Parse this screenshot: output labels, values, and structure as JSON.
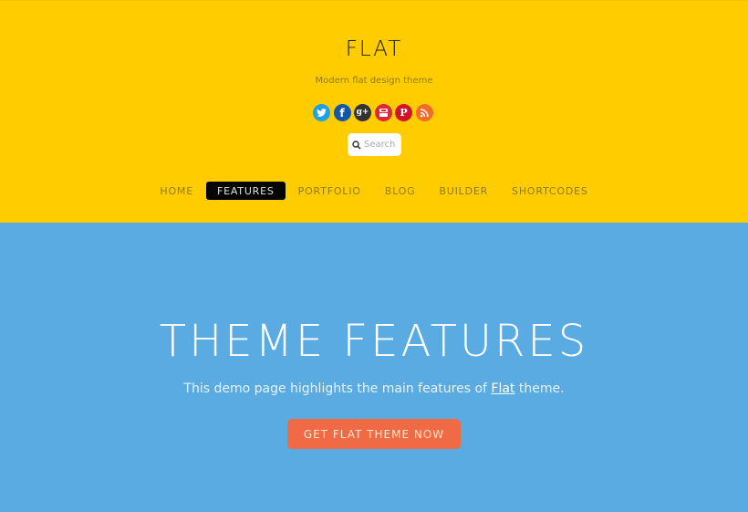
{
  "header": {
    "site_title": "FLAT",
    "tagline": "Modern flat design theme",
    "social": [
      {
        "name": "twitter-icon",
        "glyph": "t",
        "color": "#1da1e2"
      },
      {
        "name": "facebook-icon",
        "glyph": "f",
        "color": "#1457a6"
      },
      {
        "name": "google-plus-icon",
        "glyph": "g+",
        "color": "#333333"
      },
      {
        "name": "youtube-icon",
        "glyph": "You",
        "color": "#e0263a"
      },
      {
        "name": "pinterest-icon",
        "glyph": "P",
        "color": "#d0142a"
      },
      {
        "name": "rss-icon",
        "glyph": "rss",
        "color": "#f26b2a"
      }
    ],
    "search": {
      "placeholder": "Search",
      "value": ""
    },
    "colors": {
      "background": "#ffcc00"
    }
  },
  "nav": {
    "items": [
      {
        "label": "HOME",
        "active": false
      },
      {
        "label": "FEATURES",
        "active": true
      },
      {
        "label": "PORTFOLIO",
        "active": false
      },
      {
        "label": "BLOG",
        "active": false
      },
      {
        "label": "BUILDER",
        "active": false
      },
      {
        "label": "SHORTCODES",
        "active": false
      }
    ]
  },
  "hero": {
    "title": "THEME FEATURES",
    "subtitle_before": "This demo page highlights the main features of ",
    "subtitle_link": "Flat",
    "subtitle_after": " theme.",
    "cta_label": "GET FLAT THEME NOW",
    "colors": {
      "background": "#5aabe1",
      "cta": "#f06a45"
    }
  }
}
